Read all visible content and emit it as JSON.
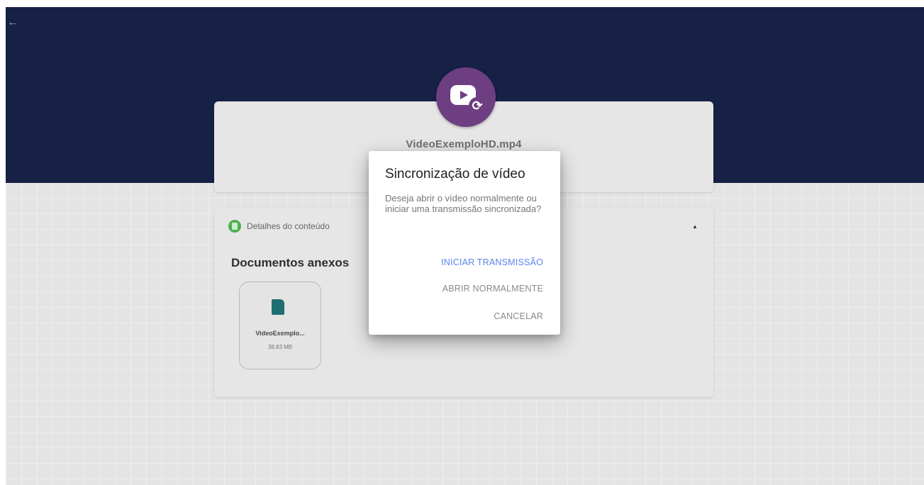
{
  "file": {
    "name": "VideoExemploHD.mp4"
  },
  "details": {
    "label": "Detalhes do conteúdo",
    "attachments_title": "Documentos anexos",
    "attachments": [
      {
        "name": "VideoExemplo...",
        "size": "38.83 MB"
      }
    ]
  },
  "dialog": {
    "title": "Sincronização de vídeo",
    "message": "Deseja abrir o vídeo normalmente ou iniciar uma transmissão sincronizada?",
    "buttons": {
      "start": "INICIAR TRANSMISSÃO",
      "open": "ABRIR NORMALMENTE",
      "cancel": "CANCELAR"
    }
  },
  "icons": {
    "back": "arrow-left-icon",
    "video": "video-sync-icon",
    "details": "document-icon",
    "collapse": "chevron-up-icon",
    "attachment": "file-icon"
  },
  "colors": {
    "banner": "#172045",
    "video_icon_bg": "#6d3f82",
    "primary_action": "#5a84e8",
    "details_icon": "#4caf50"
  }
}
